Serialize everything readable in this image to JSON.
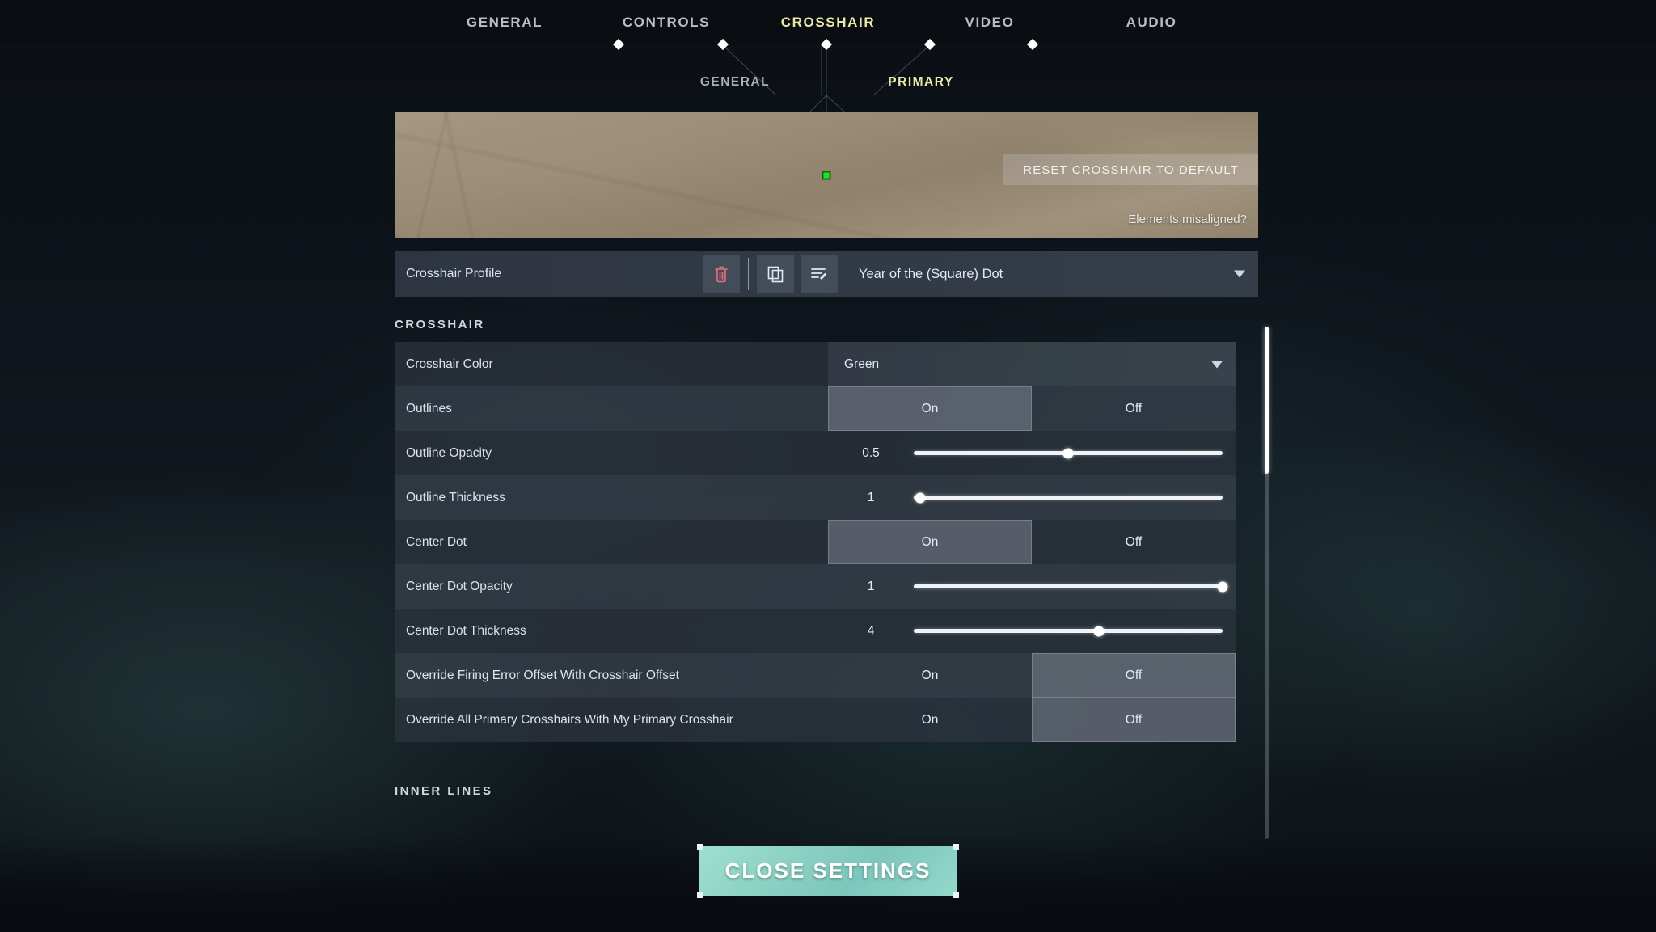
{
  "nav": {
    "tabs": [
      {
        "label": "GENERAL",
        "active": false
      },
      {
        "label": "CONTROLS",
        "active": false
      },
      {
        "label": "CROSSHAIR",
        "active": true
      },
      {
        "label": "VIDEO",
        "active": false
      },
      {
        "label": "AUDIO",
        "active": false
      }
    ]
  },
  "subnav": {
    "tabs": [
      {
        "label": "GENERAL",
        "active": false
      },
      {
        "label": "PRIMARY",
        "active": true
      }
    ]
  },
  "preview": {
    "reset_label": "RESET CROSSHAIR TO DEFAULT",
    "misaligned_label": "Elements misaligned?",
    "crosshair_color_hex": "#24e024"
  },
  "profile": {
    "label": "Crosshair Profile",
    "selected": "Year of the (Square) Dot",
    "delete_icon": "trash-icon",
    "copy_icon": "copy-icon",
    "rename_icon": "rename-icon",
    "delete_color_hex": "#e8707e"
  },
  "sections": [
    {
      "id": "crosshair",
      "title": "CROSSHAIR"
    },
    {
      "id": "inner_lines",
      "title": "INNER LINES"
    }
  ],
  "settings": [
    {
      "label": "Crosshair Color",
      "type": "dropdown",
      "value": "Green"
    },
    {
      "label": "Outlines",
      "type": "toggle",
      "options": [
        "On",
        "Off"
      ],
      "selected": "On"
    },
    {
      "label": "Outline Opacity",
      "type": "slider",
      "value": "0.5",
      "percent": 50
    },
    {
      "label": "Outline Thickness",
      "type": "slider",
      "value": "1",
      "percent": 2
    },
    {
      "label": "Center Dot",
      "type": "toggle",
      "options": [
        "On",
        "Off"
      ],
      "selected": "On"
    },
    {
      "label": "Center Dot Opacity",
      "type": "slider",
      "value": "1",
      "percent": 100
    },
    {
      "label": "Center Dot Thickness",
      "type": "slider",
      "value": "4",
      "percent": 60
    },
    {
      "label": "Override Firing Error Offset With Crosshair Offset",
      "type": "toggle",
      "options": [
        "On",
        "Off"
      ],
      "selected": "Off"
    },
    {
      "label": "Override All Primary Crosshairs With My Primary Crosshair",
      "type": "toggle",
      "options": [
        "On",
        "Off"
      ],
      "selected": "Off"
    }
  ],
  "footer": {
    "close_label": "CLOSE SETTINGS",
    "accent_hex": "#8ed3c4"
  }
}
